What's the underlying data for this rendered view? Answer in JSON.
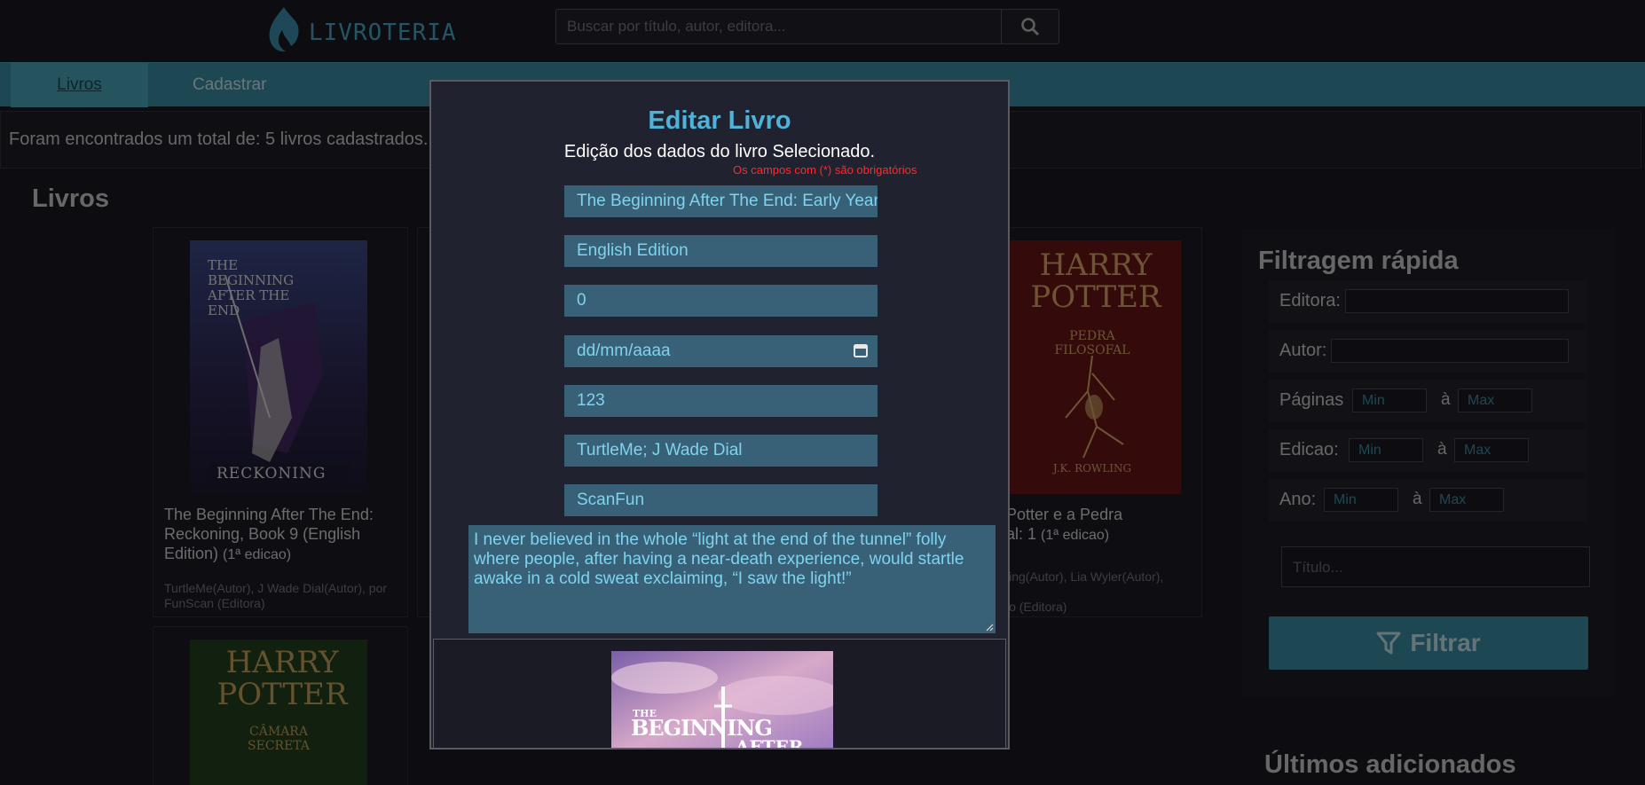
{
  "header": {
    "logo_text": "LIVROTERIA",
    "search_placeholder": "Buscar por título, autor, editora..."
  },
  "nav": {
    "tabs": [
      {
        "label": "Livros"
      },
      {
        "label": "Cadastrar"
      }
    ]
  },
  "count_text": "Foram encontrados um total de: 5 livros cadastrados.",
  "section_title": "Livros",
  "cards": [
    {
      "title": "The Beginning After The End: Reckoning, Book 9 (English Edition)",
      "edition": "(1ª edicao)",
      "meta": "TurtleMe(Autor), J Wade Dial(Autor), por",
      "meta2": "FunScan (Editora)",
      "cover_title": "THE BEGINNING AFTER THE END",
      "cover_sub": "RECKONING"
    },
    {
      "title": "Potter e a Pedra",
      "title2": "al: 1",
      "edition": "(1ª edicao)",
      "meta": "ling(Autor), Lia Wyler(Autor),",
      "meta2": "lo (Editora)",
      "cover_title": "HARRY POTTER",
      "cover_sub": "PEDRA FILOSOFAL",
      "cover_author": "J.K. ROWLING"
    },
    {
      "cover_title": "HARRY POTTER",
      "cover_sub": "CÂMARA SECRETA"
    }
  ],
  "filter": {
    "title": "Filtragem rápida",
    "editora_label": "Editora:",
    "autor_label": "Autor:",
    "paginas_label": "Páginas",
    "edicao_label": "Edicao:",
    "ano_label": "Ano:",
    "min": "Min",
    "max": "Max",
    "a": "à",
    "titulo_placeholder": "Título...",
    "button": "Filtrar"
  },
  "ultimos_title": "Últimos adicionados",
  "modal": {
    "title": "Editar Livro",
    "subtitle": "Edição dos dados do livro Selecionado.",
    "required_note": "Os campos com (*) são obrigatórios",
    "fields": {
      "titulo": "The Beginning After The End: Early Years",
      "subtitulo": "English Edition",
      "edicao": "0",
      "data": "dd/mm/aaaa",
      "paginas": "123",
      "autores": "TurtleMe; J Wade Dial",
      "editora": "ScanFun"
    },
    "descricao": "I never believed in the whole “light at the end of the tunnel” folly where people, after having a near-death experience, would startle awake in a cold sweat exclaiming, “I saw the light!”",
    "cover_text1": "THE",
    "cover_text2": "BEGINNING",
    "cover_text3": "AFTER"
  }
}
